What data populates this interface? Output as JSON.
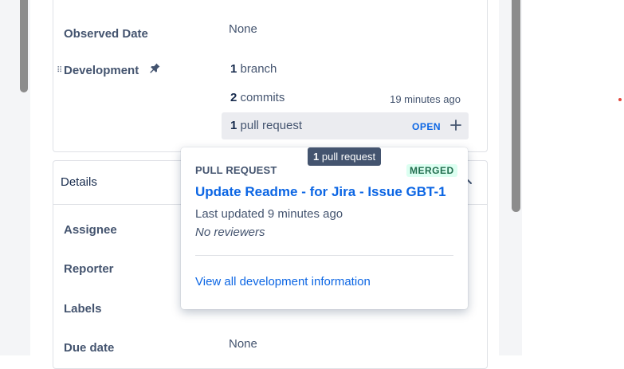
{
  "fields": {
    "observed_date": {
      "label": "Observed Date",
      "value": "None"
    },
    "development": {
      "label": "Development"
    },
    "due_date": {
      "label": "Due date",
      "value": "None"
    }
  },
  "development": {
    "branch": {
      "count": "1",
      "text": "branch"
    },
    "commits": {
      "count": "2",
      "text": "commits",
      "time": "19 minutes ago"
    },
    "pull_request": {
      "count": "1",
      "text": "pull request",
      "status": "OPEN"
    }
  },
  "details": {
    "title": "Details",
    "fields": [
      "Assignee",
      "Reporter",
      "Labels"
    ]
  },
  "tooltip": {
    "count": "1",
    "text": "pull request"
  },
  "popover": {
    "heading": "PULL REQUEST",
    "badge": "MERGED",
    "title": "Update Readme - for Jira - Issue GBT-1",
    "updated": "Last updated 9 minutes ago",
    "reviewers": "No reviewers",
    "link": "View all development information"
  },
  "colors": {
    "link": "#0c66e4",
    "merged_bg": "#dcfff1",
    "merged_text": "#216e4e",
    "tooltip_bg": "#44546f"
  },
  "icons": [
    "drag-handle-icon",
    "pin-icon",
    "plus-icon",
    "chevron-up-icon"
  ]
}
